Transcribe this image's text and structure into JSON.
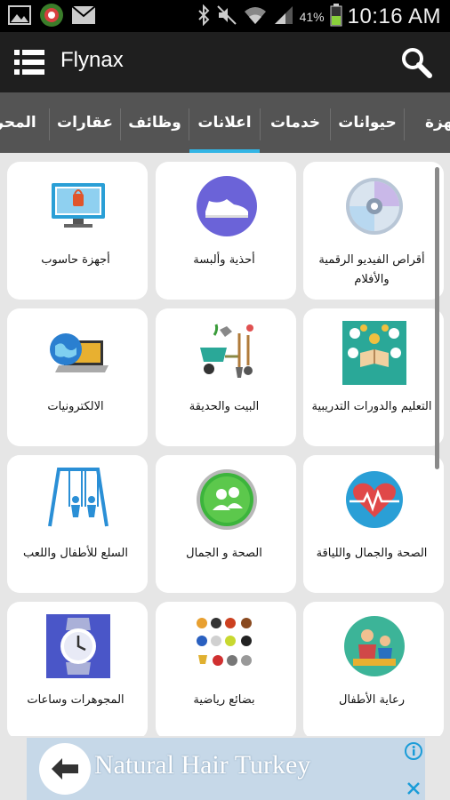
{
  "status_bar": {
    "battery_percent": "41%",
    "time": "10:16 AM",
    "icons": [
      "gallery-icon",
      "app-notification-icon",
      "mail-icon",
      "bluetooth-icon",
      "mute-icon",
      "wifi-icon",
      "signal-icon",
      "battery-icon"
    ]
  },
  "app_bar": {
    "title": "Flynax",
    "menu_icon": "menu-icon",
    "search_icon": "search-icon"
  },
  "tabs": [
    {
      "label": "جهزة"
    },
    {
      "label": "حيوانات"
    },
    {
      "label": "خدمات"
    },
    {
      "label": "اعلانات",
      "active": true
    },
    {
      "label": "وظائف"
    },
    {
      "label": "عقارات"
    },
    {
      "label": "المحر"
    }
  ],
  "categories": [
    {
      "label": "أجهزة حاسوب",
      "icon": "computer-icon"
    },
    {
      "label": "أحذية وألبسة",
      "icon": "shoe-icon"
    },
    {
      "label": "أقراص الفيديو الرقمية والأفلام",
      "icon": "disc-icon"
    },
    {
      "label": "الالكترونيات",
      "icon": "laptop-globe-icon"
    },
    {
      "label": "البيت والحديقة",
      "icon": "garden-tools-icon"
    },
    {
      "label": "التعليم والدورات التدريبية",
      "icon": "education-icon"
    },
    {
      "label": "السلع للأطفال واللعب",
      "icon": "swing-icon"
    },
    {
      "label": "الصحة و الجمال",
      "icon": "group-icon"
    },
    {
      "label": "الصحة والجمال واللياقة",
      "icon": "heart-pulse-icon"
    },
    {
      "label": "المجوهرات وساعات",
      "icon": "watch-icon"
    },
    {
      "label": "بضائع رياضية",
      "icon": "sports-balls-icon"
    },
    {
      "label": "رعاية الأطفال",
      "icon": "childcare-icon"
    }
  ],
  "ad": {
    "text": "Natural Hair Turkey",
    "back_icon": "arrow-left-icon",
    "info_icon": "info-icon",
    "close_icon": "close-icon"
  },
  "colors": {
    "accent": "#33b5e5",
    "tab_bar": "#545454",
    "app_bar": "#1f1f1f"
  }
}
